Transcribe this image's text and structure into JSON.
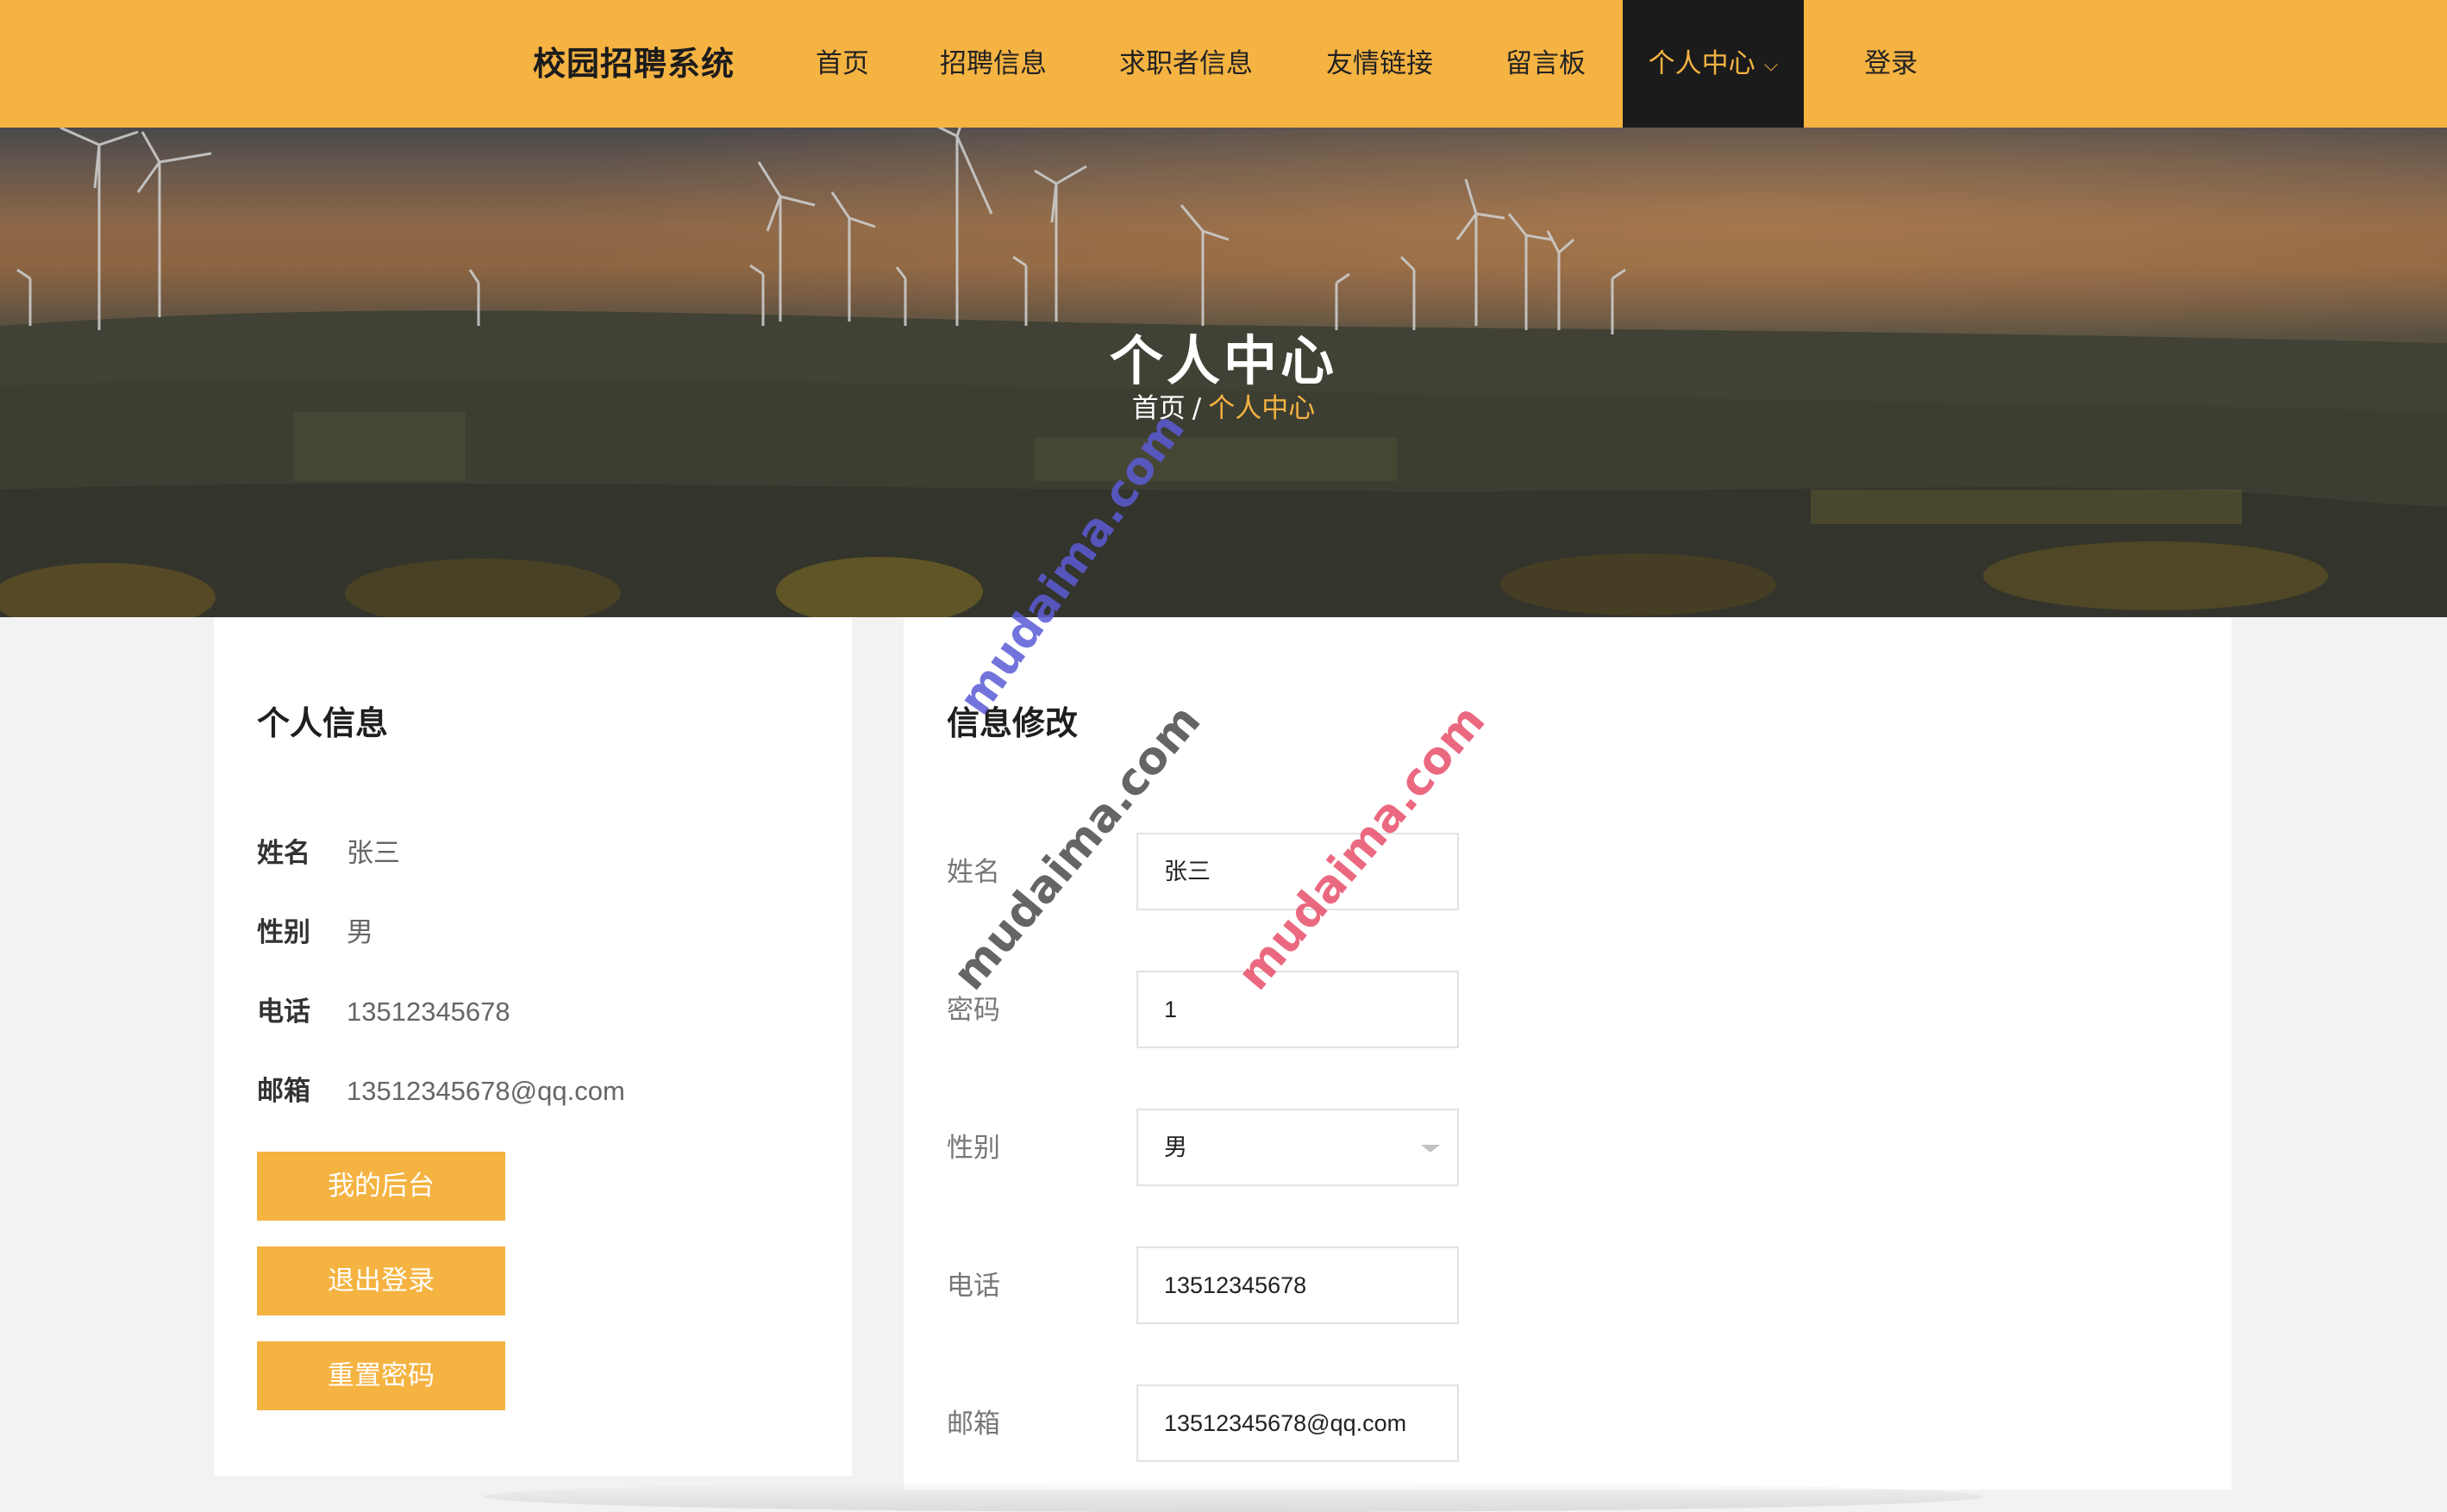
{
  "header": {
    "brand": "校园招聘系统",
    "nav": [
      {
        "label": "首页"
      },
      {
        "label": "招聘信息"
      },
      {
        "label": "求职者信息"
      },
      {
        "label": "友情链接"
      },
      {
        "label": "留言板"
      },
      {
        "label": "个人中心",
        "active": true,
        "icon": "chevron-down-icon"
      },
      {
        "label": "登录"
      }
    ]
  },
  "hero": {
    "title": "个人中心",
    "breadcrumb": {
      "home": "首页",
      "separator": "/",
      "current": "个人中心"
    }
  },
  "profile": {
    "title": "个人信息",
    "fields": [
      {
        "label": "姓名",
        "value": "张三"
      },
      {
        "label": "性别",
        "value": "男"
      },
      {
        "label": "电话",
        "value": "13512345678"
      },
      {
        "label": "邮箱",
        "value": "13512345678@qq.com"
      }
    ],
    "buttons": {
      "dashboard": "我的后台",
      "logout": "退出登录",
      "reset_password": "重置密码"
    }
  },
  "edit_form": {
    "title": "信息修改",
    "fields": [
      {
        "label": "姓名",
        "value": "张三",
        "type": "text"
      },
      {
        "label": "密码",
        "value": "1",
        "type": "password"
      },
      {
        "label": "性别",
        "value": "男",
        "type": "select"
      },
      {
        "label": "电话",
        "value": "13512345678",
        "type": "text"
      },
      {
        "label": "邮箱",
        "value": "13512345678@qq.com",
        "type": "text"
      }
    ]
  },
  "watermarks": [
    "mudaima.com",
    "mudaima.com",
    "mudaima.com"
  ],
  "colors": {
    "accent": "#f5b342",
    "nav_active_bg": "#1b1b1b",
    "watermark_blue": "#5b5bd6",
    "watermark_gray": "#555555",
    "watermark_red": "#e8506a"
  }
}
